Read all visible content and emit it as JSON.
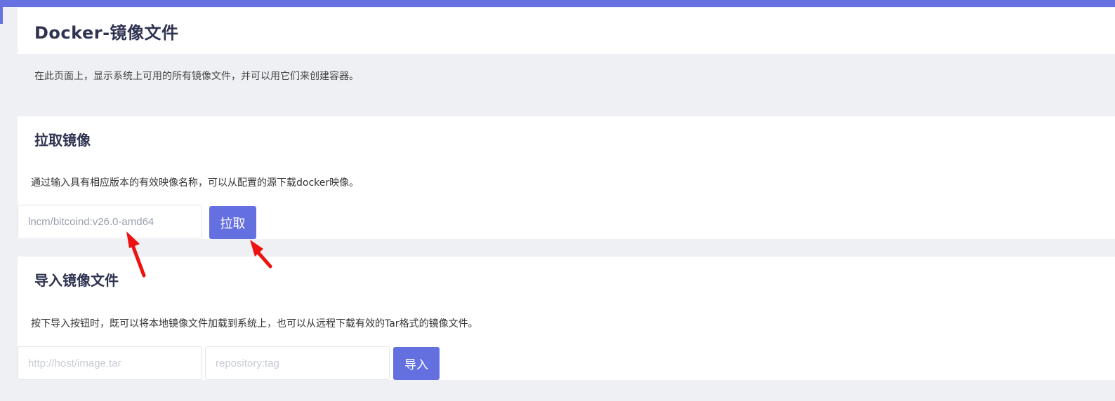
{
  "page": {
    "title": "Docker-镜像文件",
    "description": "在此页面上，显示系统上可用的所有镜像文件，并可以用它们来创建容器。"
  },
  "pull_section": {
    "title": "拉取镜像",
    "description": "通过输入具有相应版本的有效映像名称，可以从配置的源下载docker映像。",
    "image_input_value": "lncm/bitcoind:v26.0-amd64",
    "button_label": "拉取"
  },
  "import_section": {
    "title": "导入镜像文件",
    "description": "按下导入按钮时，既可以将本地镜像文件加载到系统上，也可以从远程下载有效的Tar格式的镜像文件。",
    "url_placeholder": "http://host/image.tar",
    "repo_placeholder": "repository:tag",
    "button_label": "导入"
  },
  "colors": {
    "accent": "#6570e0",
    "annotation_arrow": "#ee1111"
  }
}
